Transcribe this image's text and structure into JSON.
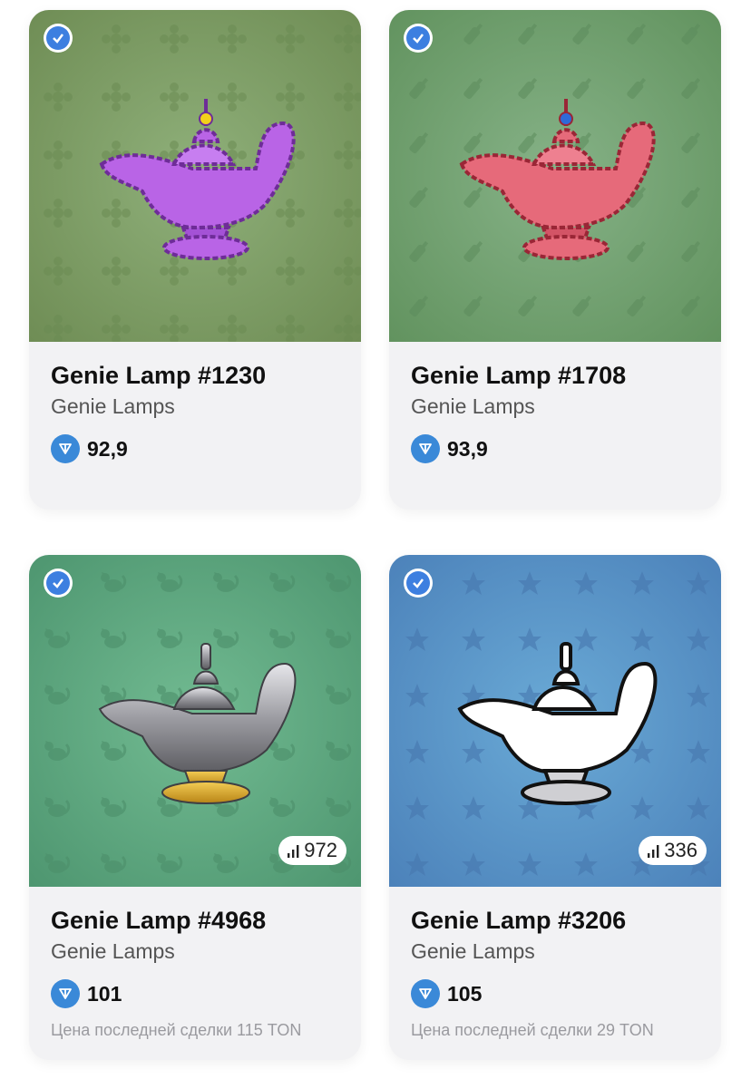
{
  "cards": [
    {
      "title": "Genie Lamp #1230",
      "collection": "Genie Lamps",
      "price": "92,9",
      "background": "#7d9e62",
      "lamp_color": "#b964e6",
      "lamp_stroke": "#6e2c98",
      "gem_color": "#f3d11a",
      "pattern_icon": "flower-icon",
      "verified_icon": "verified-icon"
    },
    {
      "title": "Genie Lamp #1708",
      "collection": "Genie Lamps",
      "price": "93,9",
      "background": "#72a373",
      "lamp_color": "#e66a7a",
      "lamp_stroke": "#9a2636",
      "gem_color": "#2e6ad8",
      "pattern_icon": "bottle-icon",
      "verified_icon": "verified-icon"
    },
    {
      "title": "Genie Lamp #4968",
      "collection": "Genie Lamps",
      "price": "101",
      "background": "#5ea882",
      "lamp_color": "#b9b9bd",
      "lamp_stroke": "#4a4a4e",
      "base_color": "#d6a42a",
      "pattern_icon": "cat-icon",
      "stat": "972",
      "last_deal_label": "Цена последней сделки",
      "last_deal_value": "115 TON",
      "verified_icon": "verified-icon"
    },
    {
      "title": "Genie Lamp #3206",
      "collection": "Genie Lamps",
      "price": "105",
      "background": "#5c93c8",
      "lamp_color": "#ffffff",
      "lamp_stroke": "#111111",
      "pattern_icon": "lily-icon",
      "stat": "336",
      "last_deal_label": "Цена последней сделки",
      "last_deal_value": "29 TON",
      "verified_icon": "verified-icon"
    }
  ],
  "icons": {
    "currency": "ton-icon",
    "stat": "signal-bars-icon"
  },
  "colors": {
    "ton_blue": "#3a89d8",
    "verified_blue": "#3d7fe0"
  }
}
